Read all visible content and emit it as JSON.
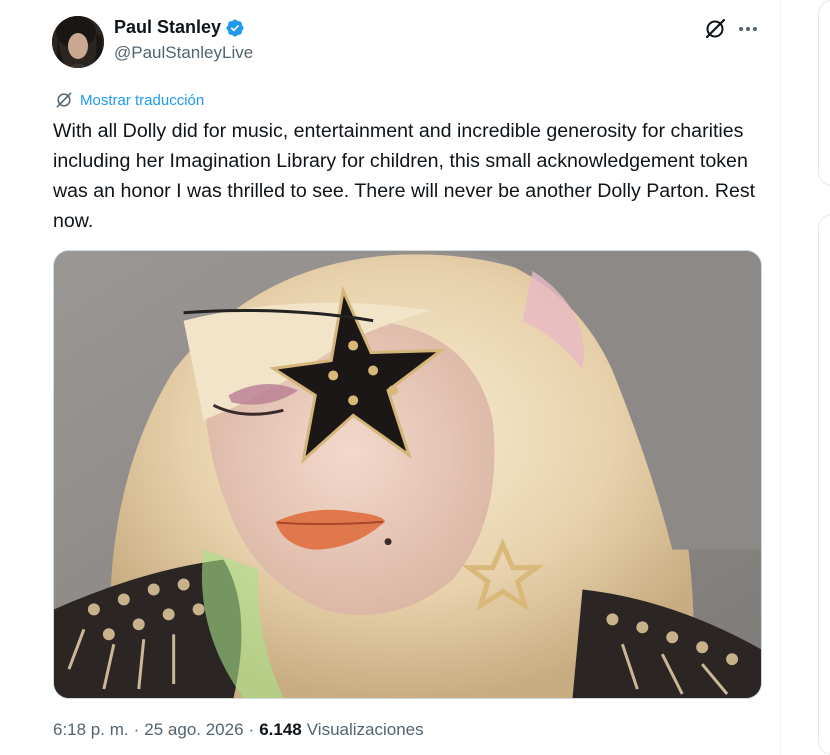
{
  "author": {
    "display_name": "Paul Stanley",
    "handle": "@PaulStanleyLive",
    "verified": true,
    "verified_color": "#1d9bf0"
  },
  "actions": {
    "grok_icon": "grok-icon",
    "more_icon": "more-icon"
  },
  "translate": {
    "label": "Mostrar traducción",
    "icon": "translate-icon"
  },
  "tweet": {
    "text": "With all Dolly did for music, entertainment and incredible generosity for charities including her Imagination Library for children, this small acknowledgement token was an honor I was thrilled to see. There will never be another Dolly Parton. Rest now."
  },
  "media": {
    "kind": "photo"
  },
  "meta": {
    "time": "6:18 p. m.",
    "sep1": "·",
    "date": "25 ago. 2026",
    "sep2": "·",
    "views_count": "6.148",
    "views_label": "Visualizaciones"
  },
  "colors": {
    "text": "#0f1419",
    "secondary": "#536471",
    "accent": "#1d9bf0",
    "border": "#cfd9de"
  }
}
